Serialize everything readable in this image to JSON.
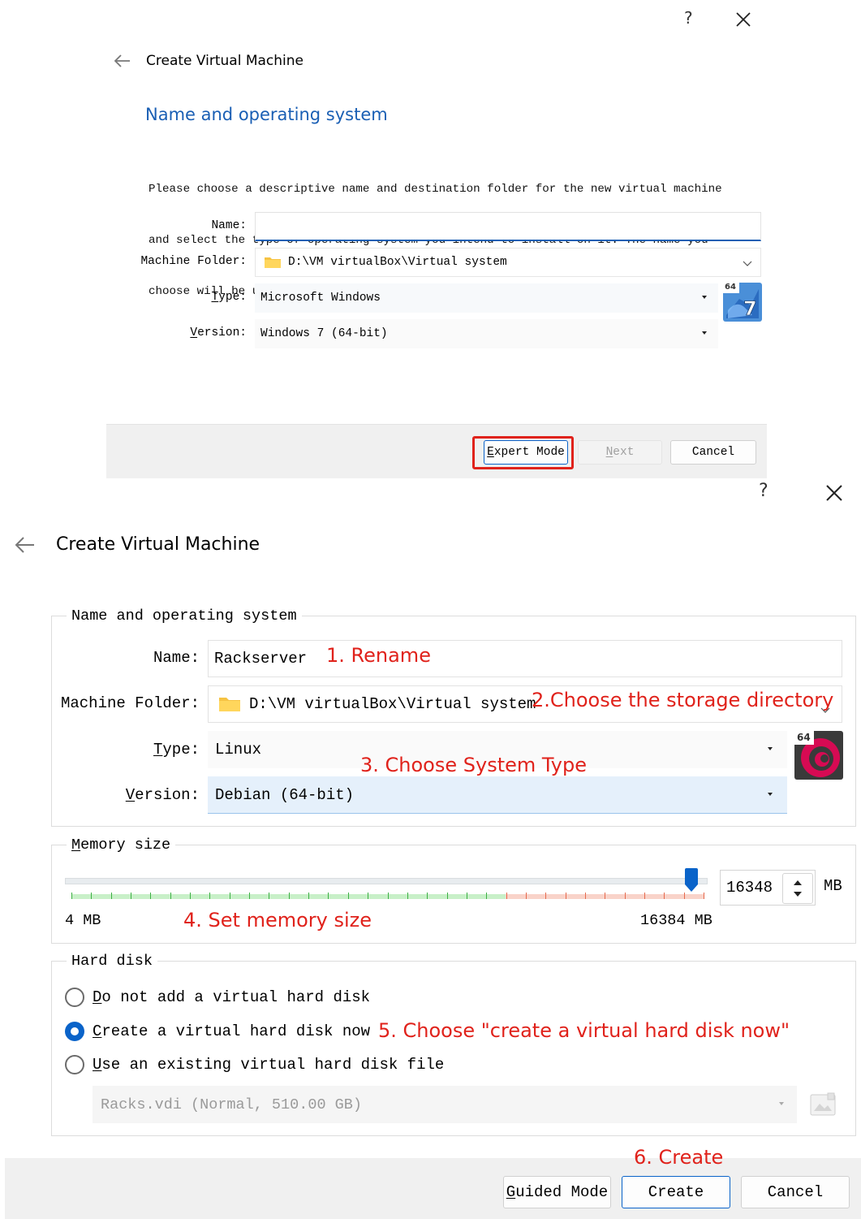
{
  "dialog1": {
    "title": "Create Virtual Machine",
    "heading": "Name and operating system",
    "description_lines": [
      "Please choose a descriptive name and destination folder for the new virtual machine",
      "and select the type of operating system you intend to install on it. The name you",
      "choose will be used throughout VirtualBox to identify this machine."
    ],
    "name_label": "Name:",
    "name_value": "",
    "folder_label": "Machine Folder:",
    "folder_value": "D:\\VM virtualBox\\Virtual system",
    "type_label_u": "T",
    "type_label_rest": "ype:",
    "type_value": "Microsoft Windows",
    "version_label_u": "V",
    "version_label_rest": "ersion:",
    "version_value": "Windows 7 (64-bit)",
    "os_badge": "64",
    "os_icon": "windows-7-icon",
    "buttons": {
      "expert_u": "E",
      "expert_rest": "xpert Mode",
      "next_u": "N",
      "next_rest": "ext",
      "cancel": "Cancel"
    },
    "help": "?",
    "highlight_color": "#e0221b"
  },
  "dialog2": {
    "title": "Create Virtual Machine",
    "group_name_os": "Name and operating system",
    "name_label": "Name:",
    "name_value": "Rackserver",
    "folder_label": "Machine Folder:",
    "folder_value": "D:\\VM virtualBox\\Virtual system",
    "type_label_u": "T",
    "type_label_rest": "ype:",
    "type_value": "Linux",
    "version_label_u": "V",
    "version_label_rest": "ersion:",
    "version_value": "Debian (64-bit)",
    "os_badge": "64",
    "os_icon": "debian-icon",
    "group_memory_u": "M",
    "group_memory_rest": "emory size",
    "memory_value": "16348",
    "memory_fraction": 0.9978,
    "memory_unit": "MB",
    "memory_min": "4 MB",
    "memory_max": "16384 MB",
    "group_disk": "Hard disk",
    "disk_options": [
      {
        "u": "D",
        "rest": "o not add a virtual hard disk",
        "selected": false
      },
      {
        "u": "C",
        "rest": "reate a virtual hard disk now",
        "selected": true
      },
      {
        "u": "U",
        "rest": "se an existing virtual hard disk file",
        "selected": false
      }
    ],
    "existing_disk": "Racks.vdi (Normal, 510.00 GB)",
    "buttons": {
      "guided_u": "G",
      "guided_rest": "uided Mode",
      "create": "Create",
      "cancel": "Cancel"
    },
    "help": "?",
    "accent_color": "#0a63c9"
  },
  "annotations": {
    "a1": "1. Rename",
    "a2": "2.Choose the storage directory",
    "a3": "3. Choose System Type",
    "a4": "4. Set memory size",
    "a5": "5. Choose \"create a virtual hard disk now\"",
    "a6": "6. Create"
  }
}
